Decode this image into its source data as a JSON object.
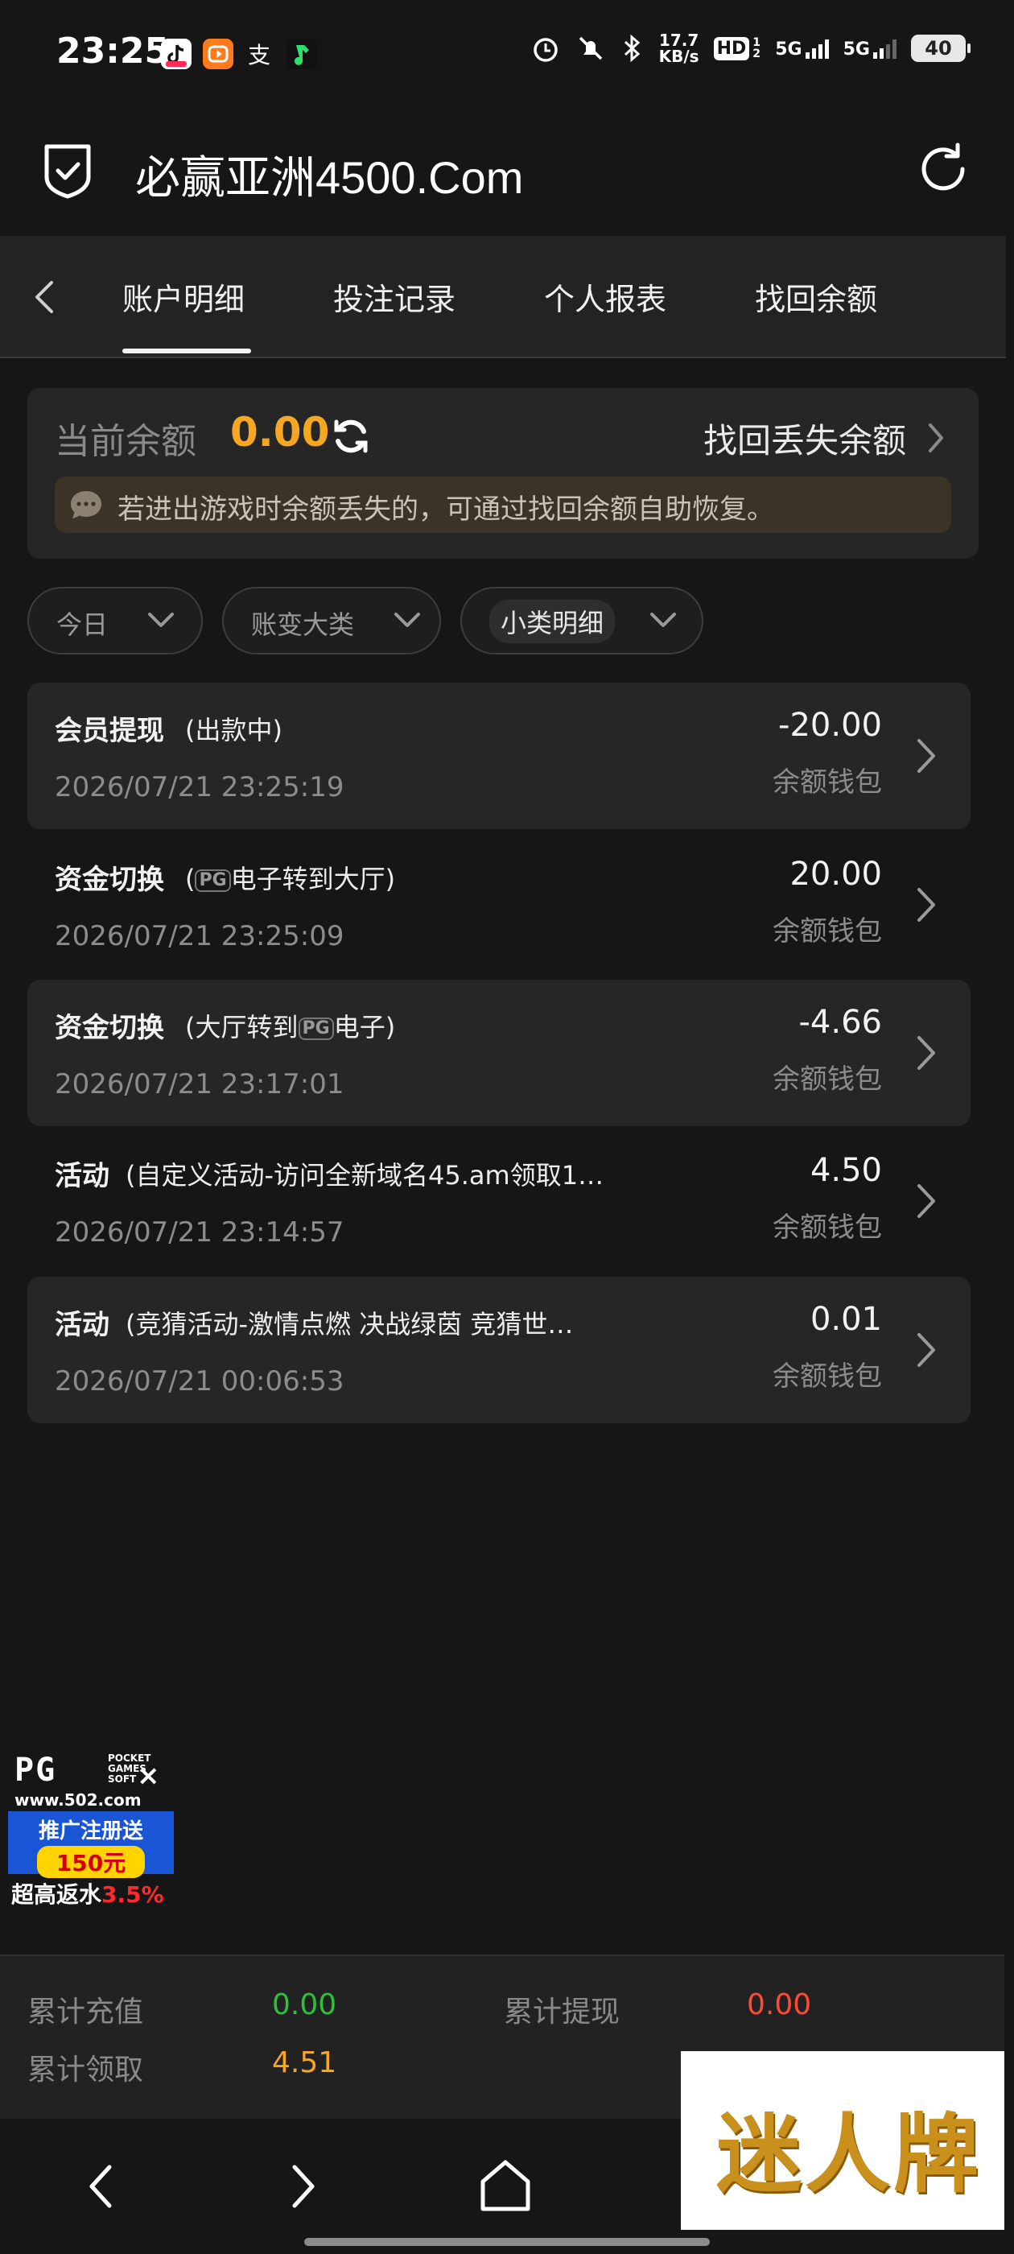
{
  "status_bar": {
    "time": "23:25",
    "speed_top": "17.7",
    "speed_bottom": "KB/s",
    "hd": "HD",
    "hd_sub": "1 2",
    "net1": "5G",
    "net2": "5G",
    "battery": "40"
  },
  "header": {
    "title": "必赢亚洲4500.Com"
  },
  "tabs": [
    {
      "label": "账户明细"
    },
    {
      "label": "投注记录"
    },
    {
      "label": "个人报表"
    },
    {
      "label": "找回余额"
    }
  ],
  "balance": {
    "label": "当前余额",
    "value": "0.00",
    "recover_label": "找回丢失余额",
    "notice": "若进出游戏时余额丢失的，可通过找回余额自助恢复。"
  },
  "filters": [
    {
      "label": "今日"
    },
    {
      "label": "账变大类"
    },
    {
      "label": "小类明细"
    }
  ],
  "transactions": [
    {
      "title": "会员提现",
      "detail": "(出款中)",
      "time": "2026/07/21 23:25:19",
      "amount": "-20.00",
      "wallet": "余额钱包"
    },
    {
      "title": "资金切换",
      "detail_pre": "(",
      "badge": "PG",
      "detail_post": "电子转到大厅)",
      "time": "2026/07/21 23:25:09",
      "amount": "20.00",
      "wallet": "余额钱包"
    },
    {
      "title": "资金切换",
      "detail_pre": "(大厅转到",
      "badge": "PG",
      "detail_post": "电子)",
      "time": "2026/07/21 23:17:01",
      "amount": "-4.66",
      "wallet": "余额钱包"
    },
    {
      "title": "活动",
      "detail": "(自定义活动-访问全新域名45.am领取1…",
      "time": "2026/07/21 23:14:57",
      "amount": "4.50",
      "wallet": "余额钱包"
    },
    {
      "title": "活动",
      "detail": "(竞猜活动-激情点燃 决战绿茵 竞猜世…",
      "time": "2026/07/21 00:06:53",
      "amount": "0.01",
      "wallet": "余额钱包"
    }
  ],
  "ad": {
    "logo": "PG",
    "sub_lines": [
      "POCKET",
      "GAMES",
      "SOFT"
    ],
    "url": "www.502.com",
    "close": "×",
    "promo_line": "推广注册送",
    "promo_amount": "150元",
    "rebate_label": "超高返水",
    "rebate_value": "3.5%"
  },
  "totals": {
    "recharge_label": "累计充值",
    "recharge_value": "0.00",
    "withdraw_label": "累计提现",
    "withdraw_value": "0.00",
    "claim_label": "累计领取",
    "claim_value": "4.51",
    "recharge_color": "#2fbf3a",
    "withdraw_color": "#ff4a3a",
    "claim_color": "#f5a623"
  },
  "watermark": {
    "text": "迷人牌"
  },
  "colors": {
    "accent": "#f5a623",
    "background": "#161616",
    "card": "#262626"
  }
}
